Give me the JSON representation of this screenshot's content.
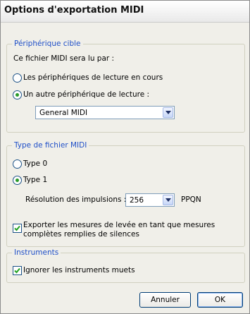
{
  "window": {
    "title": "Options d'exportation MIDI"
  },
  "device_group": {
    "legend": "Périphérique cible",
    "prompt": "Ce fichier MIDI sera lu par :",
    "options": [
      {
        "label": "Les périphériques de lecture en cours",
        "selected": false
      },
      {
        "label": "Un autre périphérique de lecture :",
        "selected": true
      }
    ],
    "device_select": {
      "value": "General MIDI"
    }
  },
  "type_group": {
    "legend": "Type de fichier MIDI",
    "options": [
      {
        "label": "Type 0",
        "selected": false
      },
      {
        "label": "Type 1",
        "selected": true
      }
    ],
    "resolution_label": "Résolution des impulsions :",
    "resolution_value": "256",
    "resolution_unit": "PPQN",
    "export_pickups": {
      "checked": true,
      "label_line1": "Exporter les mesures de levée en tant que mesures",
      "label_line2": "complètes remplies de silences"
    }
  },
  "instruments_group": {
    "legend": "Instruments",
    "ignore_muted": {
      "checked": true,
      "label": "Ignorer les instruments muets"
    }
  },
  "buttons": {
    "cancel": "Annuler",
    "ok": "OK"
  }
}
